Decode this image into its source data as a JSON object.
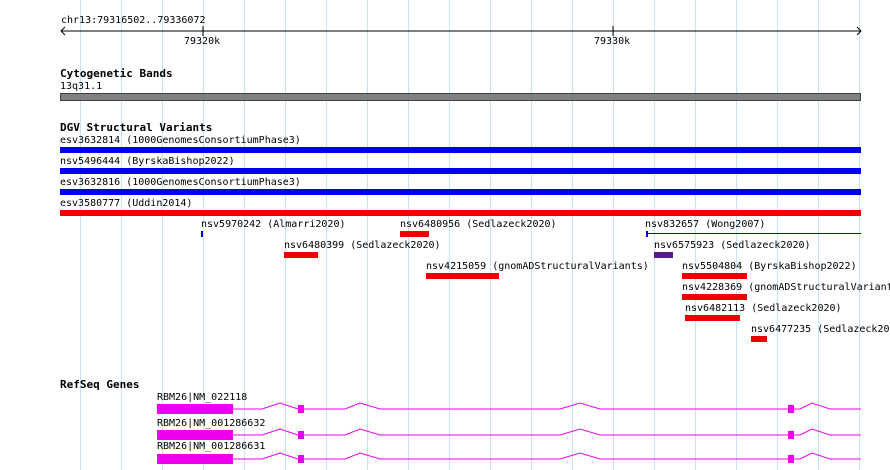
{
  "browser": {
    "location": "chr13:79316502..79336072",
    "ruler_ticks": [
      "79320k",
      "79330k"
    ]
  },
  "tracks": {
    "cytobands": {
      "title": "Cytogenetic Bands",
      "band": "13q31.1"
    },
    "dgv": {
      "title": "DGV Structural Variants",
      "variants": [
        {
          "label": "esv3632814 (1000GenomesConsortiumPhase3)",
          "color": "#0000ee"
        },
        {
          "label": "nsv5496444 (ByrskaBishop2022)",
          "color": "#0000ee"
        },
        {
          "label": "esv3632816 (1000GenomesConsortiumPhase3)",
          "color": "#0000ee"
        },
        {
          "label": "esv3580777 (Uddin2014)",
          "color": "#ee0000"
        },
        {
          "label": "nsv5970242 (Almarri2020)",
          "color": "#0000ee"
        },
        {
          "label": "nsv6480956 (Sedlazeck2020)",
          "color": "#ee0000"
        },
        {
          "label": "nsv832657 (Wong2007)",
          "color": "#0000ee"
        },
        {
          "label": "nsv6480399 (Sedlazeck2020)",
          "color": "#ee0000"
        },
        {
          "label": "nsv6575923 (Sedlazeck2020)",
          "color": "#551a8b"
        },
        {
          "label": "nsv4215059 (gnomADStructuralVariants)",
          "color": "#ee0000"
        },
        {
          "label": "nsv5504804 (ByrskaBishop2022)",
          "color": "#ee0000"
        },
        {
          "label": "nsv4228369 (gnomADStructuralVariant",
          "color": "#ee0000"
        },
        {
          "label": "nsv6482113 (Sedlazeck2020)",
          "color": "#ee0000"
        },
        {
          "label": "nsv6477235 (Sedlazeck202",
          "color": "#ee0000"
        }
      ]
    },
    "refseq": {
      "title": "RefSeq Genes",
      "genes": [
        {
          "label": "RBM26|NM_022118",
          "color": "#ee00ee"
        },
        {
          "label": "RBM26|NM_001286632",
          "color": "#ee00ee"
        },
        {
          "label": "RBM26|NM_001286631",
          "color": "#ee00ee"
        }
      ]
    }
  },
  "colors": {
    "grid": "#c8e4f0",
    "cytoband": "#808080",
    "gain": "#0000ee",
    "loss": "#ee0000",
    "complex": "#551a8b",
    "gene": "#ee00ee"
  }
}
